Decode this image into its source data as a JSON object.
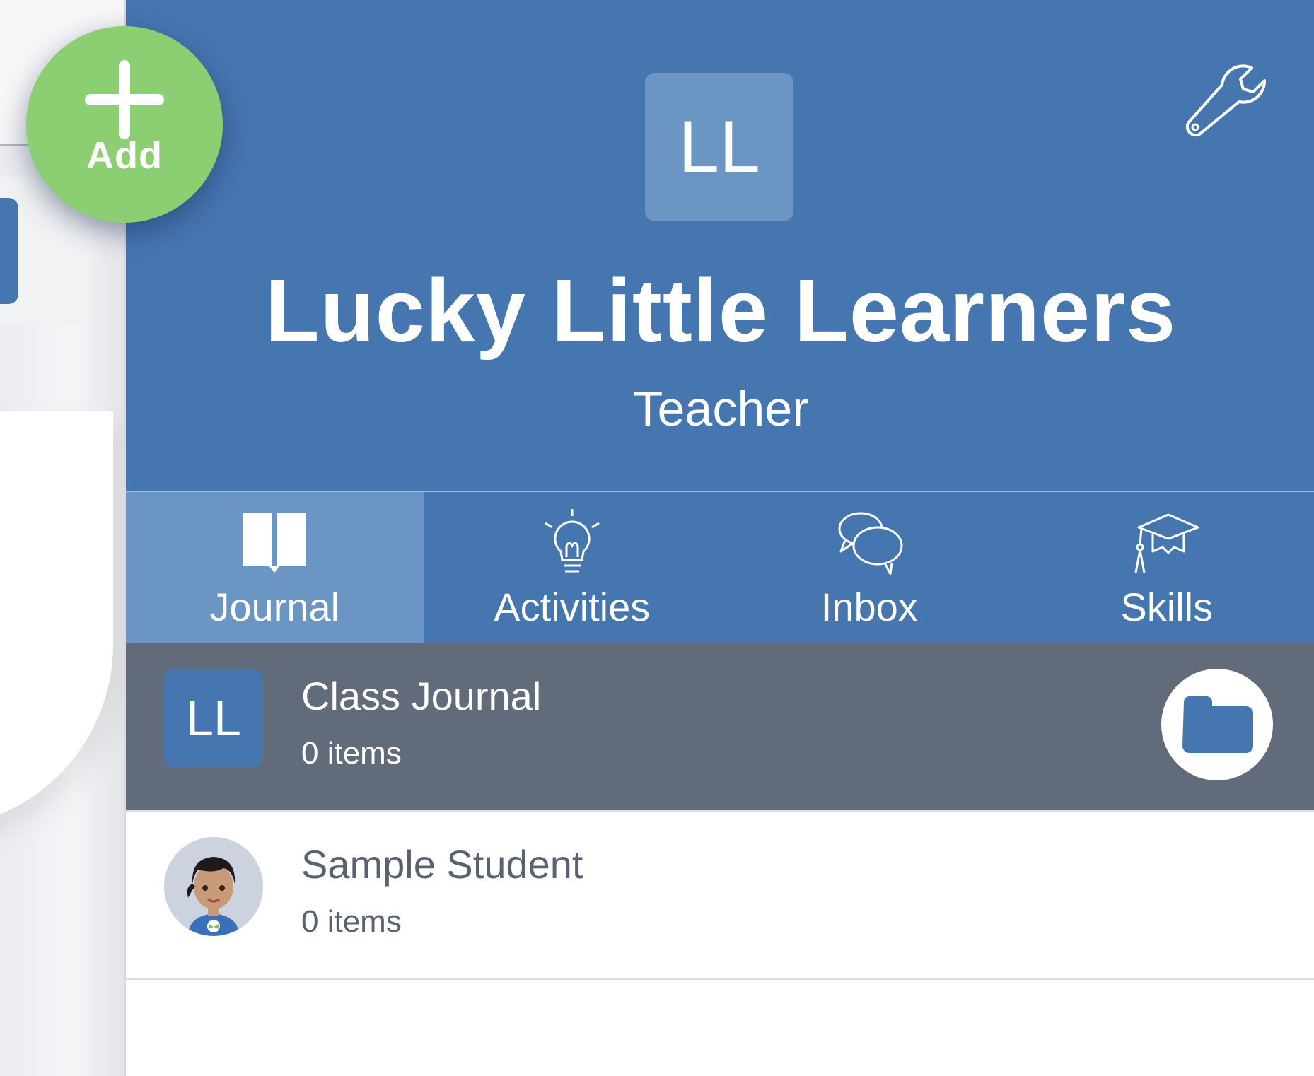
{
  "add_button": {
    "label": "Add"
  },
  "header": {
    "avatar_initials": "LL",
    "class_name": "Lucky Little Learners",
    "role": "Teacher"
  },
  "tabs": [
    {
      "label": "Journal",
      "icon": "book-icon",
      "active": true
    },
    {
      "label": "Activities",
      "icon": "lightbulb-icon",
      "active": false
    },
    {
      "label": "Inbox",
      "icon": "chat-bubbles-icon",
      "active": false
    },
    {
      "label": "Skills",
      "icon": "graduation-cap-icon",
      "active": false
    }
  ],
  "list": [
    {
      "title": "Class Journal",
      "count": "0 items",
      "avatar_initials": "LL",
      "selected": true
    },
    {
      "title": "Sample Student",
      "count": "0 items",
      "avatar": "student-avatar",
      "selected": false
    }
  ],
  "colors": {
    "header_blue": "#4676b0",
    "active_tab": "#6b95c2",
    "add_green": "#8ccf72",
    "selected_row": "#616b79"
  }
}
